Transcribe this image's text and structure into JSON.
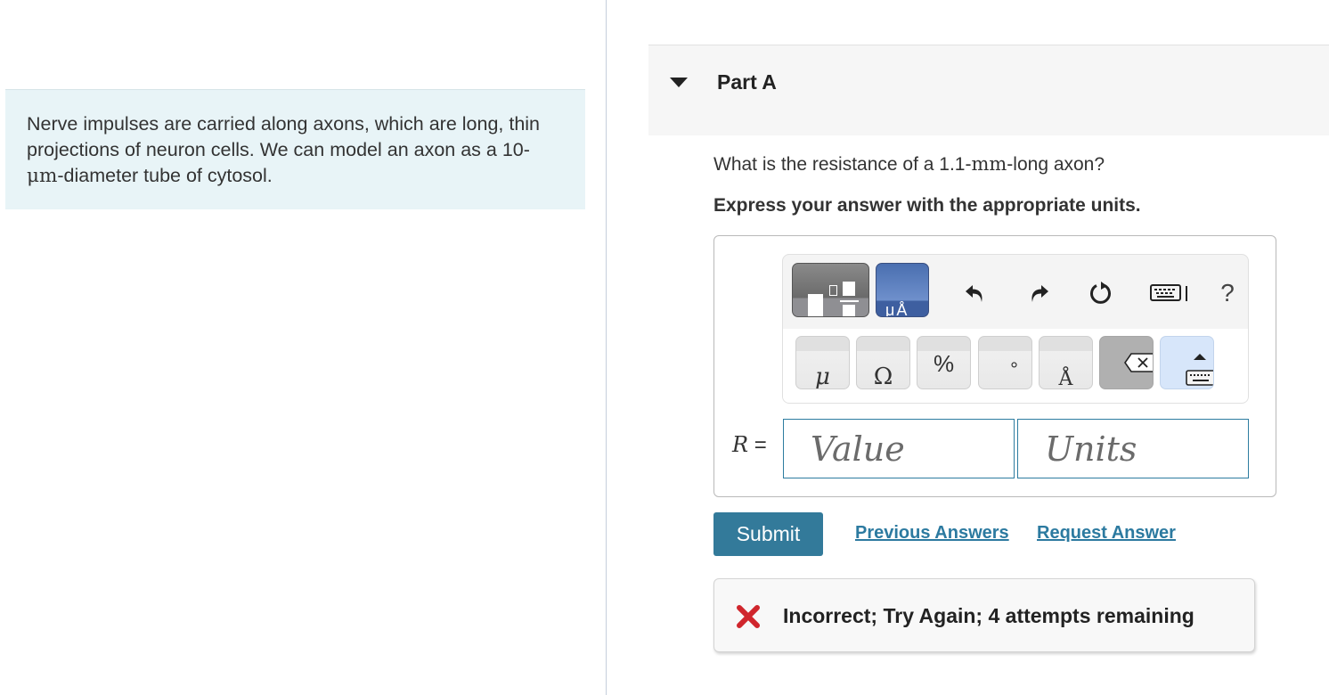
{
  "intro": {
    "text_before": "Nerve impulses are carried along axons, which are long, thin projections of neuron cells. We can model an axon as a 10-",
    "math_unit": "μm",
    "text_after": "-diameter tube of cytosol."
  },
  "part": {
    "title": "Part A",
    "question_before": "What is the resistance of a 1.1-",
    "question_unit": "mm",
    "question_after": "-long axon?",
    "instruction": "Express your answer with the appropriate units."
  },
  "toolbar": {
    "templates_button": "templates",
    "units_button_label": "μÅ",
    "undo": "undo",
    "redo": "redo",
    "reset": "reset",
    "keyboard_shortcuts": "keyboard shortcuts",
    "help": "?",
    "keys": [
      {
        "name": "mu-key",
        "glyph": "μ"
      },
      {
        "name": "ohm-key",
        "glyph": "Ω"
      },
      {
        "name": "percent-key",
        "glyph": "%"
      },
      {
        "name": "degree-key",
        "glyph": "°"
      },
      {
        "name": "angstrom-key",
        "glyph": "Å"
      },
      {
        "name": "backspace-key",
        "glyph": "backspace"
      },
      {
        "name": "keyboard-toggle-key",
        "glyph": "keyboard"
      }
    ]
  },
  "answer": {
    "variable": "R",
    "equals": "=",
    "value_placeholder": "Value",
    "value": "",
    "units_placeholder": "Units",
    "units": ""
  },
  "actions": {
    "submit": "Submit",
    "previous_answers": "Previous Answers",
    "request_answer": "Request Answer"
  },
  "feedback": {
    "status": "incorrect",
    "message": "Incorrect; Try Again; 4 attempts remaining",
    "color": "#d0262d"
  },
  "colors": {
    "accent": "#337a9a",
    "link": "#2c7aa0",
    "intro_bg": "#e8f4f7"
  }
}
